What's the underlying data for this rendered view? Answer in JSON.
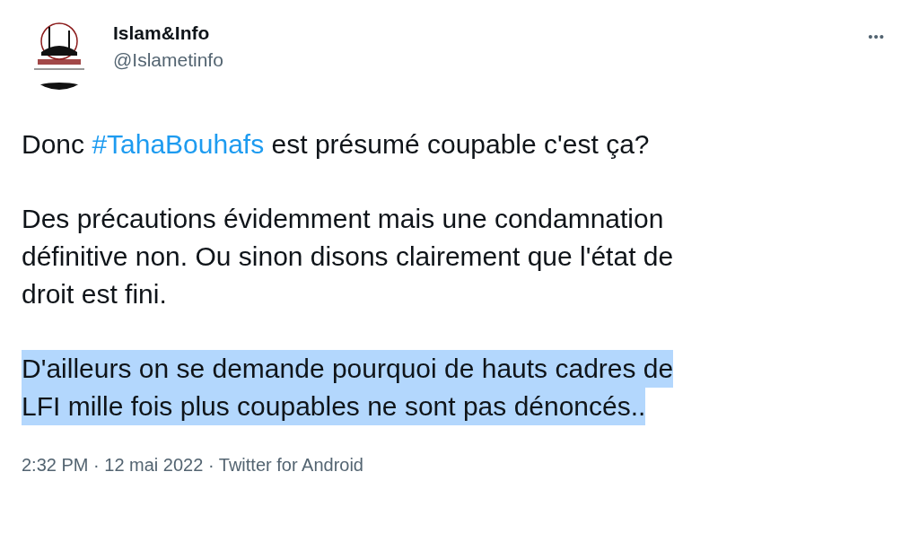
{
  "author": {
    "name": "Islam&Info",
    "handle": "@Islametinfo"
  },
  "more_button": {
    "label": "•••"
  },
  "paragraphs": [
    {
      "highlighted": false,
      "lines": [
        [
          {
            "kind": "text",
            "text": "Donc "
          },
          {
            "kind": "hashtag",
            "text": "#TahaBouhafs"
          },
          {
            "kind": "text",
            "text": " est présumé coupable c'est ça?"
          }
        ]
      ]
    },
    {
      "highlighted": false,
      "lines": [
        [
          {
            "kind": "text",
            "text": "Des précautions évidemment mais une condamnation"
          }
        ],
        [
          {
            "kind": "text",
            "text": "définitive non. Ou sinon disons clairement que l'état de"
          }
        ],
        [
          {
            "kind": "text",
            "text": "droit est fini."
          }
        ]
      ]
    },
    {
      "highlighted": true,
      "lines": [
        [
          {
            "kind": "text",
            "text": "D'ailleurs on se demande pourquoi de hauts cadres de"
          }
        ],
        [
          {
            "kind": "text",
            "text": "LFI mille fois plus coupables ne sont pas dénoncés.."
          }
        ]
      ]
    }
  ],
  "meta": {
    "time": "2:32 PM",
    "date": "12 mai 2022",
    "source": "Twitter for Android",
    "separator": "·"
  }
}
